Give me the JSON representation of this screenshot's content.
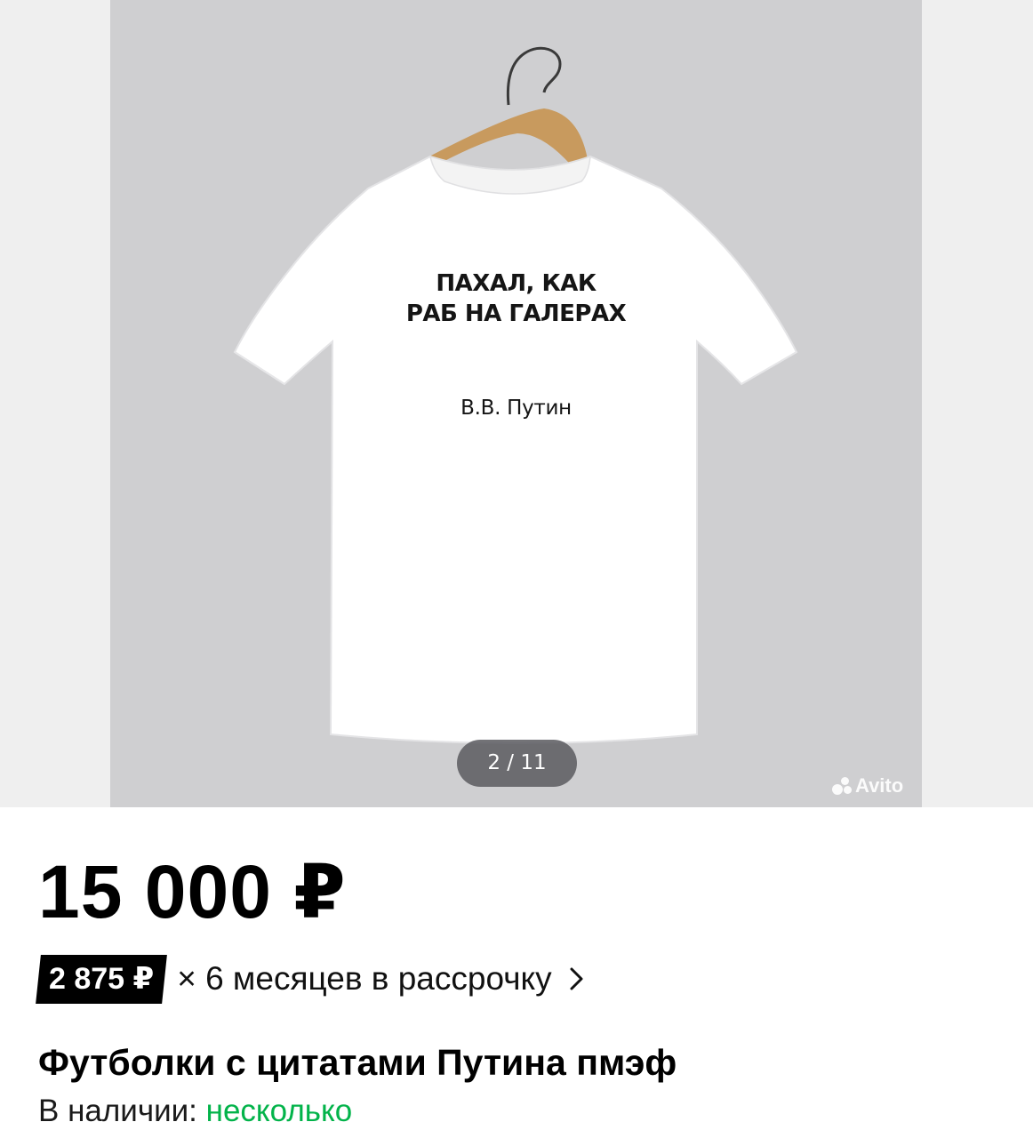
{
  "gallery": {
    "shirt_quote_line1": "ПАХАЛ, КАК",
    "shirt_quote_line2": "РАБ НА ГАЛЕРАХ",
    "shirt_author": "В.В. Путин",
    "counter": "2 / 11",
    "watermark": "Avito"
  },
  "listing": {
    "price": "15 000 ₽",
    "installment_amount": "2 875 ₽",
    "installment_terms": "× 6 месяцев в рассрочку",
    "title": "Футболки с цитатами Путина пмэф",
    "availability_label": "В наличии:",
    "availability_value": "несколько"
  },
  "colors": {
    "availability_green": "#02b34a",
    "badge_black": "#000000",
    "photo_background": "#cfcfd1"
  },
  "icons": {
    "installment_arrow": "chevron-right-icon",
    "watermark_logo": "avito-logo-icon"
  }
}
